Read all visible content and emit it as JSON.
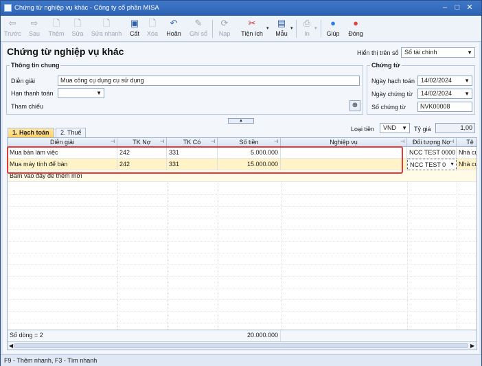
{
  "window": {
    "title": "Chứng từ nghiệp vụ khác - Công ty cổ phần MISA"
  },
  "toolbar": {
    "buttons": [
      {
        "label": "Trước",
        "icon": "arrow-left-icon"
      },
      {
        "label": "Sau",
        "icon": "arrow-right-icon"
      },
      {
        "label": "Thêm",
        "icon": "add-doc-icon"
      },
      {
        "label": "Sửa",
        "icon": "edit-doc-icon"
      },
      {
        "label": "Sửa nhanh",
        "icon": "quick-edit-icon"
      },
      {
        "label": "Cất",
        "icon": "save-icon"
      },
      {
        "label": "Xóa",
        "icon": "delete-icon"
      },
      {
        "label": "Hoãn",
        "icon": "undo-icon"
      },
      {
        "label": "Ghi sổ",
        "icon": "post-icon"
      },
      {
        "label": "Nạp",
        "icon": "reload-icon"
      },
      {
        "label": "Tiện ích",
        "icon": "tools-icon"
      },
      {
        "label": "Mẫu",
        "icon": "template-icon"
      },
      {
        "label": "In",
        "icon": "print-icon"
      },
      {
        "label": "Giúp",
        "icon": "help-icon"
      },
      {
        "label": "Đóng",
        "icon": "close-icon"
      }
    ]
  },
  "page": {
    "title": "Chứng từ nghiệp vụ khác",
    "hien_thi_label": "Hiển thị trên sổ",
    "hien_thi_value": "Sổ tài chính"
  },
  "general": {
    "title": "Thông tin chung",
    "dien_giai_label": "Diễn giải",
    "dien_giai_value": "Mua công cụ dụng cụ sử dụng",
    "han_tt_label": "Hạn thanh toán",
    "han_tt_value": "",
    "tham_chieu_label": "Tham chiếu"
  },
  "voucher": {
    "title": "Chứng từ",
    "ngay_hach_toan_label": "Ngày hạch toán",
    "ngay_hach_toan_value": "14/02/2024",
    "ngay_chung_tu_label": "Ngày chứng từ",
    "ngay_chung_tu_value": "14/02/2024",
    "so_chung_tu_label": "Số chứng từ",
    "so_chung_tu_value": "NVK00008"
  },
  "tabs": {
    "hach_toan": "1. Hạch toán",
    "thue": "2. Thuế"
  },
  "currency": {
    "loai_tien_label": "Loại tiền",
    "loai_tien_value": "VND",
    "ty_gia_label": "Tỷ giá",
    "ty_gia_value": "1,00"
  },
  "grid": {
    "headers": {
      "dien_giai": "Diễn giải",
      "tk_no": "TK Nợ",
      "tk_co": "TK Có",
      "so_tien": "Số tiền",
      "nghiep_vu": "Nghiệp vụ",
      "doi_tuong_no": "Đối tượng Nợ",
      "ten": "Tê"
    },
    "rows": [
      {
        "dien_giai": "Mua bàn làm việc",
        "tk_no": "242",
        "tk_co": "331",
        "so_tien": "5.000.000",
        "nghiep_vu": "",
        "doi_tuong_no": "NCC TEST 0000",
        "ten": "Nhà cu"
      },
      {
        "dien_giai": "Mua máy tính để bàn",
        "tk_no": "242",
        "tk_co": "331",
        "so_tien": "15.000.000",
        "nghiep_vu": "",
        "doi_tuong_no": "NCC TEST 0",
        "ten": "Nhà cu"
      }
    ],
    "add_row_hint": "Bấm vào đây để thêm mới",
    "footer_count": "Số dòng = 2",
    "footer_total": "20.000.000"
  },
  "status": {
    "text": "F9 - Thêm nhanh, F3 - Tìm nhanh"
  },
  "colors": {
    "titlebar": "#2d62b2",
    "highlight": "#e03a3a",
    "selected_row": "#fff3c7",
    "active_tab": "#ffd36b"
  }
}
